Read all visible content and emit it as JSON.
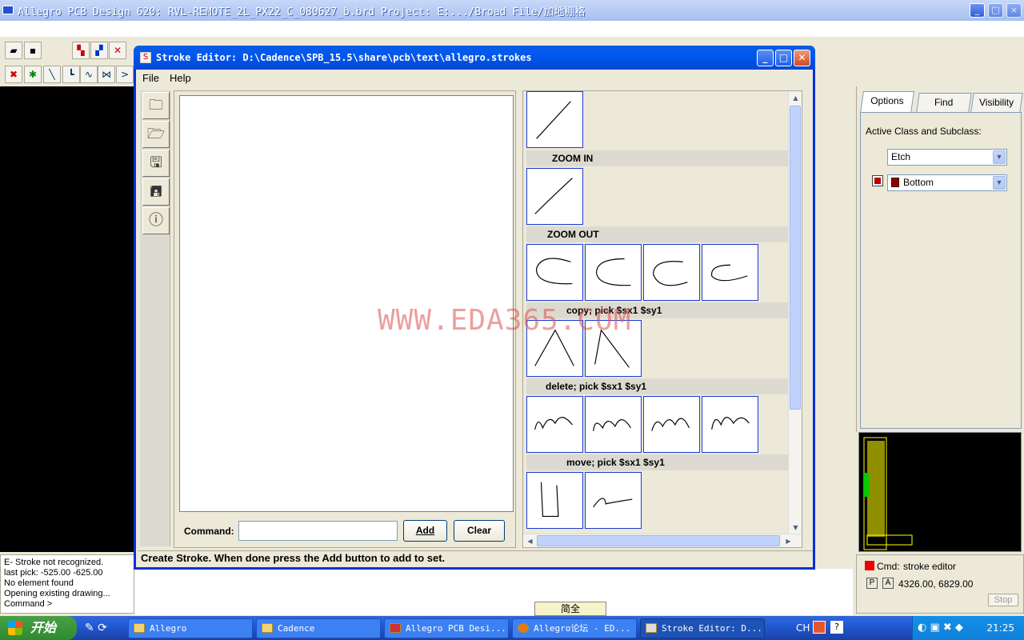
{
  "app": {
    "title": "Allegro PCB Design 620: RVL-REMOTE_2L_PX22_C_080627_b.brd  Project: E:.../Broad File/加地棚格",
    "controls": [
      "_",
      "□",
      "×"
    ]
  },
  "console": {
    "lines": [
      "E- Stroke not recognized.",
      "last pick:  -525.00  -625.00",
      "No element found",
      "Opening existing drawing...",
      "Command >"
    ]
  },
  "right_panel": {
    "tabs": [
      "Options",
      "Find",
      "Visibility"
    ],
    "active_class_label": "Active Class and Subclass:",
    "class_value": "Etch",
    "subclass_value": "Bottom",
    "cmd_label": "Cmd:",
    "cmd_value": "stroke editor",
    "p_label": "P",
    "a_label": "A",
    "coords": "4326.00, 6829.00",
    "stop_label": "Stop"
  },
  "dialog": {
    "title": "Stroke Editor: D:\\Cadence\\SPB_15.5\\share\\pcb\\text\\allegro.strokes",
    "menu": [
      "File",
      "Help"
    ],
    "command_label": "Command:",
    "command_value": "",
    "add_label": "Add",
    "clear_label": "Clear",
    "status": "Create Stroke. When done press the Add button to add to set.",
    "categories": [
      "ZOOM IN",
      "ZOOM OUT",
      "copy; pick $sx1 $sy1",
      "delete; pick $sx1 $sy1",
      "move; pick $sx1 $sy1"
    ]
  },
  "watermark": "WWW.EDA365.COM",
  "ime": "简全",
  "taskbar": {
    "start_label": "开始",
    "buttons": [
      "Allegro",
      "Cadence",
      "Allegro PCB Desi...",
      "Allegro论坛 - ED...",
      "Stroke Editor: D..."
    ],
    "lang": "CH",
    "clock": "21:25"
  },
  "colors": {
    "xp_blue": "#0058ee",
    "subclass_swatch": "#8b0000",
    "thumb_border": "#1a3ad9"
  }
}
